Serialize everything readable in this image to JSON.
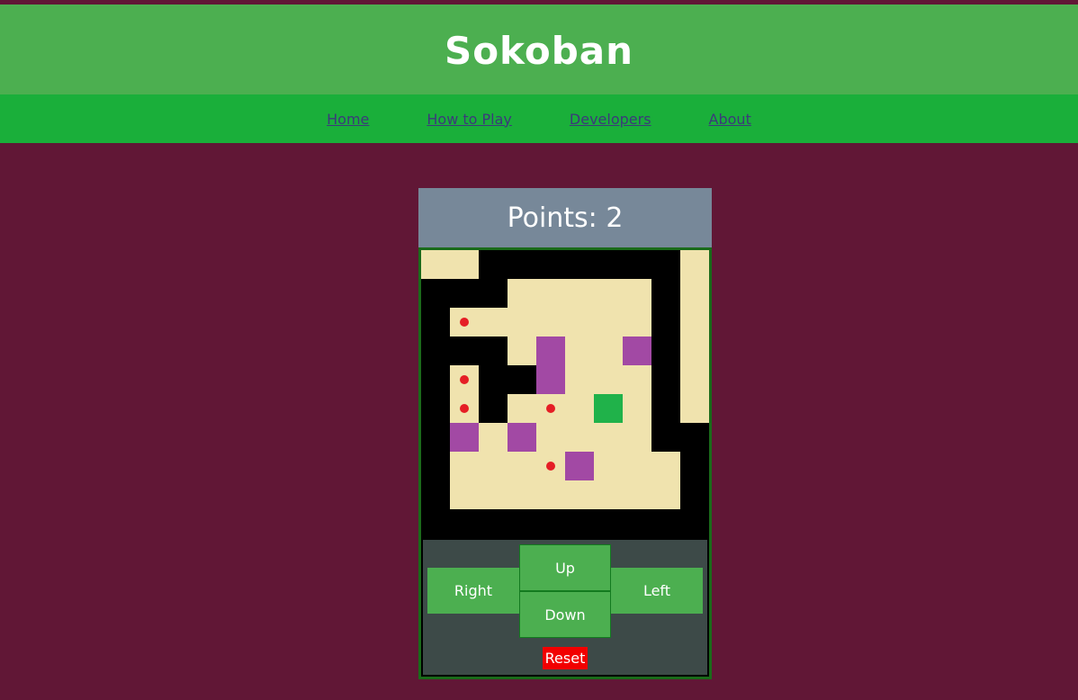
{
  "header": {
    "title": "Sokoban"
  },
  "nav": [
    {
      "label": "Home"
    },
    {
      "label": "How to Play"
    },
    {
      "label": "Developers"
    },
    {
      "label": "About"
    }
  ],
  "game": {
    "points_text": "Points: 2",
    "points": 2,
    "grid": [
      "FF#######F",
      "###FFFFF#F",
      "#TFFFFFF#F",
      "###FBFFB#F",
      "#T##BFFF#F",
      "#T#FTFPF#F",
      "#BFBFFFF##",
      "#FFFTBFFF#",
      "#FFFFFFFF#",
      "##########"
    ],
    "legend": {
      "#": "wall",
      "F": "floor",
      "T": "target",
      "B": "box",
      "P": "player"
    },
    "colors": {
      "wall": "#000000",
      "floor": "#f0e3ae",
      "box": "#a249a4",
      "player": "#20b24a",
      "target": "#e51e25"
    }
  },
  "controls": {
    "up": "Up",
    "down": "Down",
    "right": "Right",
    "left": "Left",
    "reset": "Reset"
  }
}
